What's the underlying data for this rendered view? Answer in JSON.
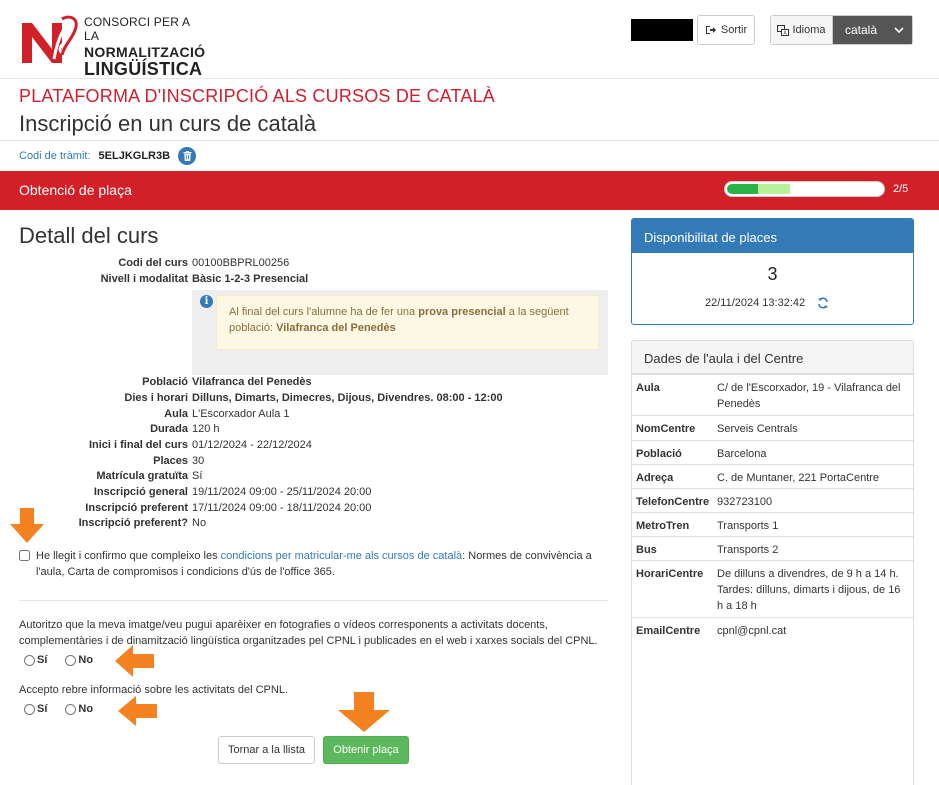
{
  "header": {
    "logo_line1": "CONSORCI PER A LA",
    "logo_line2": "NORMALITZACIÓ",
    "logo_line3": "LINGÜÍSTICA",
    "logout_label": "Sortir",
    "language_label": "Idioma",
    "language_selected": "català"
  },
  "titles": {
    "platform": "PLATAFORMA D'INSCRIPCIÓ ALS CURSOS DE CATALÀ",
    "page": "Inscripció en un curs de català",
    "tramit_label": "Codi de tràmit:",
    "tramit_code": "5ELJKGLR3B"
  },
  "step": {
    "title": "Obtenció de plaça",
    "progress_text": "2/5",
    "progress_fraction": 0.4
  },
  "detail": {
    "title": "Detall del curs",
    "rows_top": [
      {
        "k": "Codi del curs",
        "v": "00100BBPRL00256",
        "bold": false
      },
      {
        "k": "Nivell i modalitat",
        "v": "Bàsic 1-2-3 Presencial",
        "bold": true
      }
    ],
    "info_text_1": "Al final del curs l'alumne ha de fer una ",
    "info_bold_1": "prova presencial",
    "info_text_2": " a la següent població: ",
    "info_bold_2": "Vilafranca del Penedès",
    "rows_bottom": [
      {
        "k": "Població",
        "v": "Vilafranca del Penedès",
        "bold": true
      },
      {
        "k": "Dies i horari",
        "v": "Dilluns, Dimarts, Dimecres, Dijous, Divendres. 08:00 - 12:00",
        "bold": true
      },
      {
        "k": "Aula",
        "v": "L'Escorxador Aula 1",
        "bold": false
      },
      {
        "k": "Durada",
        "v": "120 h",
        "bold": false
      },
      {
        "k": "Inici i final del curs",
        "v": "01/12/2024 - 22/12/2024",
        "bold": false
      },
      {
        "k": "Places",
        "v": "30",
        "bold": false
      },
      {
        "k": "Matrícula gratuïta",
        "v": "Sí",
        "bold": false
      },
      {
        "k": "Inscripció general",
        "v": "19/11/2024 09:00 - 25/11/2024 20:00",
        "bold": false
      },
      {
        "k": "Inscripció preferent",
        "v": "17/11/2024 09:00 - 18/11/2024 20:00",
        "bold": false
      },
      {
        "k": "Inscripció preferent?",
        "v": "No",
        "bold": false
      }
    ]
  },
  "conditions": {
    "text_before": "He llegit i confirmo que compleixo les ",
    "link": "condicions per matricular-me als cursos de català",
    "text_after": ": Normes de convivència a l'aula, Carta de compromisos i condicions d'ús de l'office 365."
  },
  "image_consent": {
    "text": "Autoritzo que la meva imatge/veu pugui aparèixer en fotografies o vídeos corresponents a activitats docents, complementàries i de dinamització lingüística organitzades pel CPNL i publicades en el web i xarxes socials del CPNL.",
    "yes": "Sí",
    "no": "No"
  },
  "info_consent": {
    "text": "Accepto rebre informació sobre les activitats del CPNL.",
    "yes": "Sí",
    "no": "No"
  },
  "buttons": {
    "back": "Tornar a la llista",
    "get": "Obtenir plaça"
  },
  "availability": {
    "title": "Disponibilitat de places",
    "count": "3",
    "datetime": "22/11/2024 13:32:42"
  },
  "centre": {
    "title": "Dades de l'aula i del Centre",
    "rows": [
      {
        "k": "Aula",
        "v": "C/ de l'Escorxador, 19 - Vilafranca del Penedès"
      },
      {
        "k": "NomCentre",
        "v": "Serveis Centrals"
      },
      {
        "k": "Població",
        "v": "Barcelona"
      },
      {
        "k": "Adreça",
        "v": "C. de Muntaner, 221 PortaCentre"
      },
      {
        "k": "TelefonCentre",
        "v": "932723100"
      },
      {
        "k": "MetroTren",
        "v": "Transports 1"
      },
      {
        "k": "Bus",
        "v": "Transports 2"
      },
      {
        "k": "HorariCentre",
        "v": "De dilluns a divendres, de 9 h a 14 h. Tardes: dilluns, dimarts i dijous, de 16 h a 18 h"
      },
      {
        "k": "EmailCentre",
        "v": "cpnl@cpnl.cat"
      }
    ]
  },
  "colors": {
    "brand_red": "#d12027",
    "primary_blue": "#337ab7",
    "success_green": "#5cb85c",
    "annotation_orange": "#f58220"
  }
}
